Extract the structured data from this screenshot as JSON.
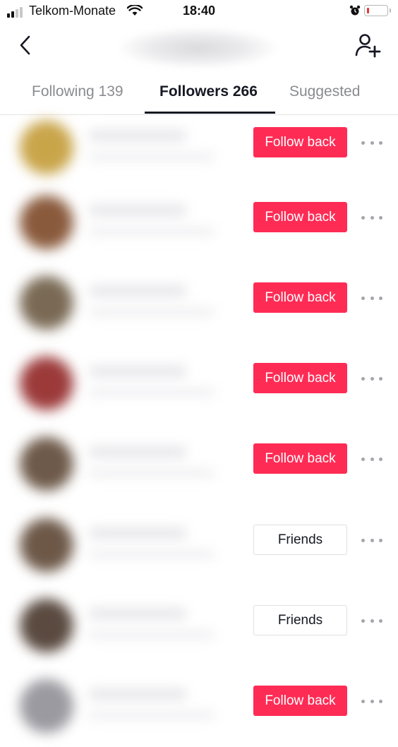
{
  "status_bar": {
    "carrier": "Telkom-Monate",
    "time": "18:40",
    "signal_bars_active": 2,
    "signal_bars_total": 4,
    "battery_level": "low",
    "battery_color": "#e53935",
    "icons": [
      "signal-icon",
      "wifi-icon",
      "alarm-icon",
      "battery-icon"
    ]
  },
  "nav": {
    "back_icon": "chevron-left-icon",
    "title": "",
    "add_friend_icon": "person-add-icon"
  },
  "tabs": [
    {
      "label": "Following 139",
      "active": false
    },
    {
      "label": "Followers 266",
      "active": true
    },
    {
      "label": "Suggested",
      "active": false
    }
  ],
  "colors": {
    "accent": "#fe2c55",
    "text_primary": "#161823",
    "text_secondary": "#8a8b91"
  },
  "followers": [
    {
      "button_label": "Follow back",
      "button_type": "follow",
      "avatar_tone": "#c9a54a"
    },
    {
      "button_label": "Follow back",
      "button_type": "follow",
      "avatar_tone": "#8a5a3c"
    },
    {
      "button_label": "Follow back",
      "button_type": "follow",
      "avatar_tone": "#7a6a55"
    },
    {
      "button_label": "Follow back",
      "button_type": "follow",
      "avatar_tone": "#9c3a3a"
    },
    {
      "button_label": "Follow back",
      "button_type": "follow",
      "avatar_tone": "#6e5a4a"
    },
    {
      "button_label": "Friends",
      "button_type": "friends",
      "avatar_tone": "#6d5848"
    },
    {
      "button_label": "Friends",
      "button_type": "friends",
      "avatar_tone": "#5a4a40"
    },
    {
      "button_label": "Follow back",
      "button_type": "follow",
      "avatar_tone": "#9a9aa0"
    }
  ]
}
